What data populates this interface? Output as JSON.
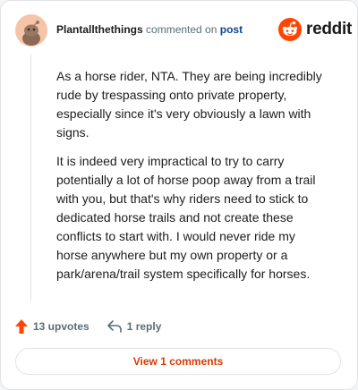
{
  "header": {
    "username": "Plantallthethings",
    "action_text": "commented on",
    "post_link": "post",
    "brand_word": "reddit"
  },
  "comment": {
    "paragraphs": [
      "As a horse rider, NTA. They are being incredibly rude by trespassing onto private property, especially since it's very obviously a lawn with signs.",
      "It is indeed very impractical to try to carry potentially a lot of horse poop away from a trail with you, but that's why riders need to stick to dedicated horse trails and not create these conflicts to start with. I would never ride my horse anywhere but my own property or a park/arena/trail system specifically for horses."
    ]
  },
  "actions": {
    "upvotes": "13 upvotes",
    "replies": "1 reply"
  },
  "view_comments_label": "View 1 comments",
  "colors": {
    "brand": "#ff4500",
    "link": "#0a449b",
    "view_comments": "#d93a00",
    "muted": "#576f76"
  },
  "icons": {
    "avatar": "snoo-avatar",
    "brand": "reddit-logo-icon",
    "upvote": "upvote-arrow-icon",
    "reply": "reply-arrow-icon"
  }
}
